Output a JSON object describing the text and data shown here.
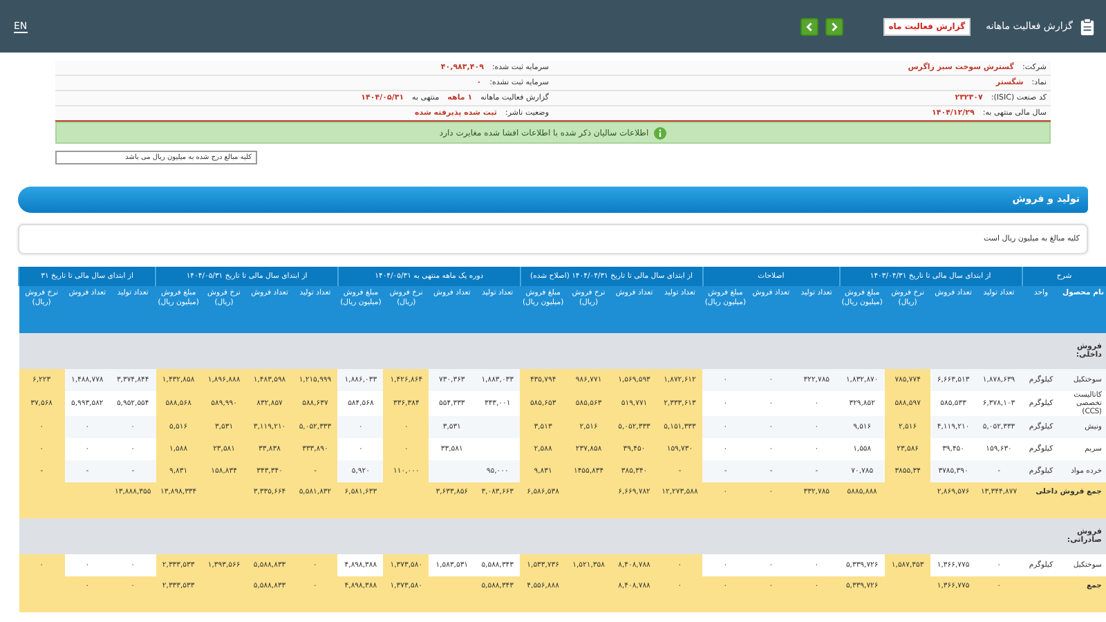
{
  "top_bar": {
    "title": "گزارش فعالیت ماهانه",
    "report_button": "گزارش فعالیت ماه",
    "language": "EN"
  },
  "info": {
    "rows": [
      {
        "col_1": [
          {
            "kind": "label",
            "text": "شرکت:"
          },
          {
            "kind": "value",
            "text": "گسترش سوخت سبز زاگرس"
          }
        ],
        "col_2": [
          {
            "kind": "label",
            "text": "سرمایه ثبت شده:"
          },
          {
            "kind": "value",
            "text": "۴۰,۹۸۳,۴۰۹"
          }
        ]
      },
      {
        "col_1": [
          {
            "kind": "label",
            "text": "نماد:"
          },
          {
            "kind": "value",
            "text": "شگستر"
          }
        ],
        "col_2": [
          {
            "kind": "label",
            "text": "سرمایه ثبت نشده:"
          },
          {
            "kind": "value",
            "text": "۰"
          }
        ]
      },
      {
        "col_1": [
          {
            "kind": "label",
            "text": "کد صنعت (ISIC):"
          },
          {
            "kind": "value",
            "text": "۲۳۲۳۰۷"
          }
        ],
        "col_2": [
          {
            "kind": "label",
            "text": "گزارش فعالیت ماهانه"
          },
          {
            "kind": "value",
            "text": "۱ ماهه"
          },
          {
            "kind": "label",
            "text": "منتهی به"
          },
          {
            "kind": "value",
            "text": "۱۴۰۴/۰۵/۳۱"
          }
        ]
      },
      {
        "col_1": [
          {
            "kind": "label",
            "text": "سال مالی منتهی به:"
          },
          {
            "kind": "value",
            "text": "۱۴۰۴/۱۲/۲۹"
          }
        ],
        "col_2": [
          {
            "kind": "label",
            "text": "وضعیت ناشر:"
          },
          {
            "kind": "value",
            "text": "ثبت شده پذیرفته شده"
          }
        ]
      }
    ],
    "notice": "اطلاعات سالیان ذکر شده با اطلاعات افشا شده مغایرت دارد",
    "unit_select": "کلیه مبالغ درج شده به میلیون ریال می باشد"
  },
  "section": {
    "title": "تولید و فروش",
    "note": "کلیه مبالغ به میلیون ریال است"
  },
  "table": {
    "head_label": "شرح",
    "name_column": "نام محصول",
    "unit_column": "واحد",
    "groups": [
      {
        "label": "از ابتدای سال مالی تا تاریخ ۱۴۰۳/۰۴/۳۱",
        "columns": [
          {
            "label": "تعداد تولید",
            "highlighted": false
          },
          {
            "label": "تعداد فروش",
            "highlighted": false
          },
          {
            "label": "نرخ فروش (ریال)",
            "highlighted": true
          },
          {
            "label": "مبلغ فروش (میلیون ریال)",
            "highlighted": false
          }
        ]
      },
      {
        "label": "اصلاحات",
        "columns": [
          {
            "label": "تعداد تولید",
            "highlighted": false
          },
          {
            "label": "تعداد فروش",
            "highlighted": false
          },
          {
            "label": "مبلغ فروش (میلیون ریال)",
            "highlighted": false
          }
        ]
      },
      {
        "label": "از ابتدای سال مالی تا تاریخ ۱۴۰۴/۰۴/۳۱ (اصلاح شده)",
        "columns": [
          {
            "label": "تعداد تولید",
            "highlighted": true
          },
          {
            "label": "تعداد فروش",
            "highlighted": true
          },
          {
            "label": "نرخ فروش (ریال)",
            "highlighted": true
          },
          {
            "label": "مبلغ فروش (میلیون ریال)",
            "highlighted": true
          }
        ]
      },
      {
        "label": "دوره یک ماهه منتهی به ۱۴۰۴/۰۵/۳۱",
        "columns": [
          {
            "label": "تعداد تولید",
            "highlighted": false
          },
          {
            "label": "تعداد فروش",
            "highlighted": false
          },
          {
            "label": "نرخ فروش (ریال)",
            "highlighted": true
          },
          {
            "label": "مبلغ فروش (میلیون ریال)",
            "highlighted": false
          }
        ]
      },
      {
        "label": "از ابتدای سال مالی تا تاریخ ۱۴۰۴/۰۵/۳۱",
        "columns": [
          {
            "label": "تعداد تولید",
            "highlighted": true
          },
          {
            "label": "تعداد فروش",
            "highlighted": true
          },
          {
            "label": "نرخ فروش (ریال)",
            "highlighted": true
          },
          {
            "label": "مبلغ فروش (میلیون ریال)",
            "highlighted": true
          }
        ]
      },
      {
        "label": "از ابتدای سال مالی تا تاریخ ۳۱",
        "columns": [
          {
            "label": "تعداد تولید",
            "highlighted": false
          },
          {
            "label": "تعداد فروش",
            "highlighted": false
          },
          {
            "label": "نرخ فروش (ریال)",
            "highlighted": true
          }
        ]
      }
    ],
    "rows": [
      {
        "kind": "group",
        "name": "فروش داخلی:"
      },
      {
        "kind": "item",
        "name": "سوختکیل",
        "unit": "کیلوگرم",
        "cells": [
          "۱,۸۷۸,۶۳۹",
          "۶,۶۶۳,۵۱۳",
          "۷۸۵,۷۷۴",
          "۱,۸۳۲,۸۷۰",
          "۳۲۲,۷۸۵",
          "۰",
          "۰",
          "۱,۸۷۲,۶۱۲",
          "۱,۵۶۹,۵۹۳",
          "۹۸۶,۷۷۱",
          "۴۳۵,۷۹۴",
          "۱,۸۸۳,۰۳۳",
          "۷۳۰,۳۶۳",
          "۱,۴۲۶,۸۶۴",
          "۱,۸۸۶,۰۳۳",
          "۱,۲۱۵,۹۹۹",
          "۱,۴۸۳,۵۹۸",
          "۱,۸۹۶,۸۸۸",
          "۱,۴۳۲,۸۵۸",
          "۳,۳۷۴,۸۴۴",
          "۱,۴۸۸,۷۷۸",
          "۶,۲۲۳"
        ]
      },
      {
        "kind": "item",
        "name": "کاتالیست تخصصی (CCS)",
        "unit": "کیلوگرم",
        "cells": [
          "۶,۳۷۸,۱۰۳",
          "۵۸۵,۵۳۳",
          "۵۸۸,۵۹۷",
          "۳۲۹,۸۵۲",
          "۰",
          "۰",
          "۰",
          "۲,۳۳۳,۶۱۳",
          "۵۱۹,۷۷۱",
          "۵۸۵,۵۶۳",
          "۵۸۵,۶۵۳",
          "۳۴۳,۰۰۱",
          "۵۵۴,۳۳۳",
          "۳۳۶,۳۸۴",
          "۵۸۴,۵۶۸",
          "۵۸۸,۶۳۷",
          "۸۳۲,۸۵۷",
          "۵۸۹,۹۹۰",
          "۵۸۸,۵۶۸",
          "۵,۹۵۲,۵۵۴",
          "۵,۹۹۳,۵۸۲",
          "۳۷,۵۶۸"
        ]
      },
      {
        "kind": "item",
        "name": "ونیش",
        "unit": "کیلوگرم",
        "cells": [
          "۵,۰۵۲,۳۳۳",
          "۴,۱۱۹,۲۱۰",
          "۲,۵۱۶",
          "۹,۵۱۶",
          "۰",
          "۰",
          "۰",
          "۵,۱۵۱,۳۳۳",
          "۵,۰۵۲,۳۳۳",
          "۲,۵۱۶",
          "۳,۵۱۳",
          null,
          "۳,۵۳۱",
          "۰",
          "۰",
          "۵,۰۵۲,۳۳۳",
          "۳,۱۱۹,۲۱۰",
          "۳,۵۳۱",
          "۵,۵۱۶",
          "۰",
          "۰",
          "۰"
        ]
      },
      {
        "kind": "item",
        "name": "سریم",
        "unit": "کیلوگرم",
        "cells": [
          "۱۵۹,۶۳۰",
          "۳۹,۴۵۰",
          "۲۳,۵۸۶",
          "۱,۵۵۸",
          "۰",
          "۰",
          "۰",
          "۱۵۹,۷۳۰",
          "۳۹,۴۵۰",
          "۲۳۷,۸۵۸",
          "۲,۵۸۸",
          null,
          "۳۳,۵۸۱",
          "۰",
          "۰",
          "۳۳۳,۸۹۰",
          "۳۳,۸۳۸",
          "۲۳,۵۸۱",
          "۱,۵۸۸",
          "۰",
          "۰",
          "۰"
        ]
      },
      {
        "kind": "item",
        "name": "خرده مواد",
        "unit": "کیلوگرم",
        "cells": [
          "-",
          "۳۷۸۵,۳۹۰",
          "۳۸۵۵,۳۴",
          "۷۰,۷۸۵",
          "-",
          "-",
          "-",
          "-",
          "۳۸۵,۳۴۰",
          "۱۴۵۵,۸۳۴",
          "۹,۸۳۱",
          "۹۵,۰۰۰",
          null,
          "۱۱۰,۰۰۰",
          "۵,۹۲۰",
          "-",
          "۳۴۳,۳۴۰",
          "۱۵۸,۸۳۴",
          "۹,۸۳۱",
          "-",
          "-",
          "-"
        ]
      },
      {
        "kind": "total",
        "name": "جمع فروش داخلی",
        "cells": [
          "۱۳,۳۴۴,۸۷۷",
          "۲,۸۶۹,۵۷۶",
          null,
          "۵۸۸۵,۸۸۸",
          "۳۳۲,۷۸۵",
          "۰",
          "۰",
          "۱۲,۲۷۳,۵۸۸",
          "۶,۶۶۹,۷۸۲",
          null,
          "۶,۵۸۶,۵۳۸",
          "۳,۰۸۳,۶۶۳",
          "۳,۶۳۳,۸۵۶",
          null,
          "۶,۵۸۱,۶۳۳",
          "۵,۵۸۱,۸۳۲",
          "۳,۳۳۵,۶۶۴",
          null,
          "۱۳,۸۹۸,۳۳۴",
          "۱۳,۸۸۸,۳۵۵",
          null,
          null
        ]
      },
      {
        "kind": "group",
        "name": "فروش صادراتی:"
      },
      {
        "kind": "item",
        "name": "سوختکیل",
        "unit": "کیلوگرم",
        "cells": [
          "۰",
          "۱,۳۶۶,۷۷۵",
          "۱,۵۸۷,۳۵۳",
          "۵,۳۳۹,۷۲۶",
          "۰",
          "۰",
          "۰",
          "۰",
          "۸,۴۰۸,۷۸۸",
          "۱,۵۲۱,۳۵۸",
          "۱,۵۳۳,۷۳۶",
          "۵,۵۸۸,۳۴۳",
          "۱,۵۸۳,۵۳۱",
          "۱,۳۷۳,۵۸۰",
          "۴,۸۹۸,۳۸۸",
          "۰",
          "۵,۵۸۸,۸۳۳",
          "۱,۳۹۳,۵۶۶",
          "۲,۳۳۳,۵۳۳",
          "۰",
          "۰",
          "۰"
        ]
      },
      {
        "kind": "total",
        "name": "جمع",
        "cells": [
          "۰",
          "۱,۳۶۶,۷۷۵",
          null,
          "۵,۳۳۹,۷۲۶",
          "۰",
          "۰",
          "۰",
          "۰",
          "۸,۴۰۸,۷۸۸",
          null,
          "۴,۵۵۶,۸۸۸",
          "۵,۵۸۸,۳۴۳",
          null,
          "۱,۳۷۳,۵۸۰",
          "۴,۸۹۸,۳۸۸",
          "۰",
          "۵,۵۸۸,۸۳۳",
          null,
          "۲,۳۳۳,۵۳۳",
          "۰",
          "۰",
          null
        ]
      }
    ]
  }
}
